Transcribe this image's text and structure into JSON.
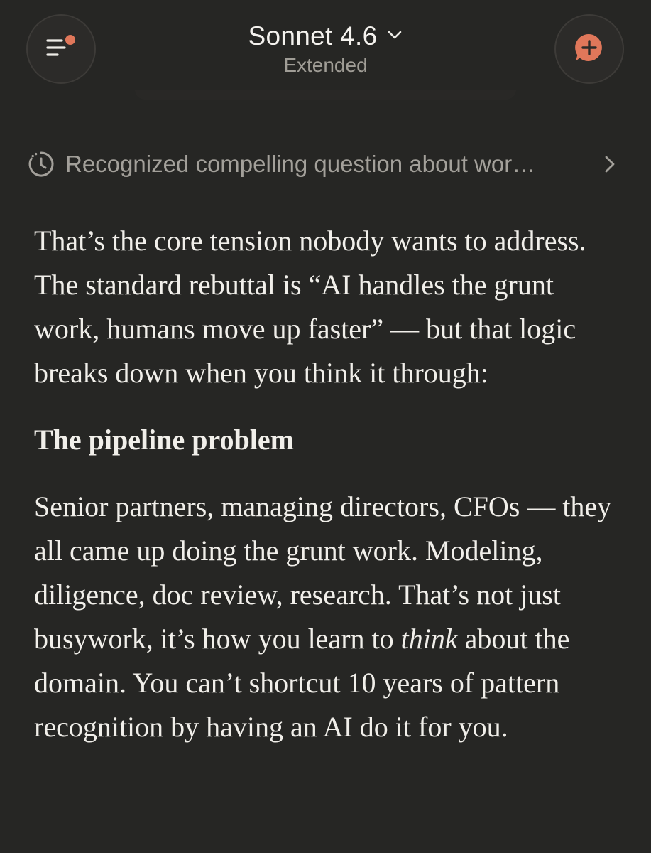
{
  "header": {
    "model_name": "Sonnet 4.6",
    "model_mode": "Extended",
    "menu_icon": "menu-notification-icon",
    "new_chat_icon": "new-chat-plus-icon",
    "accent_color": "#e0775a"
  },
  "thinking": {
    "summary": "Recognized compelling question about wor…",
    "icon": "clock-icon"
  },
  "response": {
    "paragraph_1": "That’s the core tension nobody wants to address. The standard rebuttal is “AI handles the grunt work, humans move up faster” — but that logic breaks down when you think it through:",
    "heading": "The pipeline problem",
    "paragraph_2_before": "Senior partners, managing directors, CFOs — they all came up doing the grunt work. Modeling, diligence, doc review, research. That’s not just busywork, it’s how you learn to ",
    "paragraph_2_emphasis": "think",
    "paragraph_2_after": " about the domain. You can’t shortcut 10 years of pattern recognition by having an AI do it for you."
  }
}
